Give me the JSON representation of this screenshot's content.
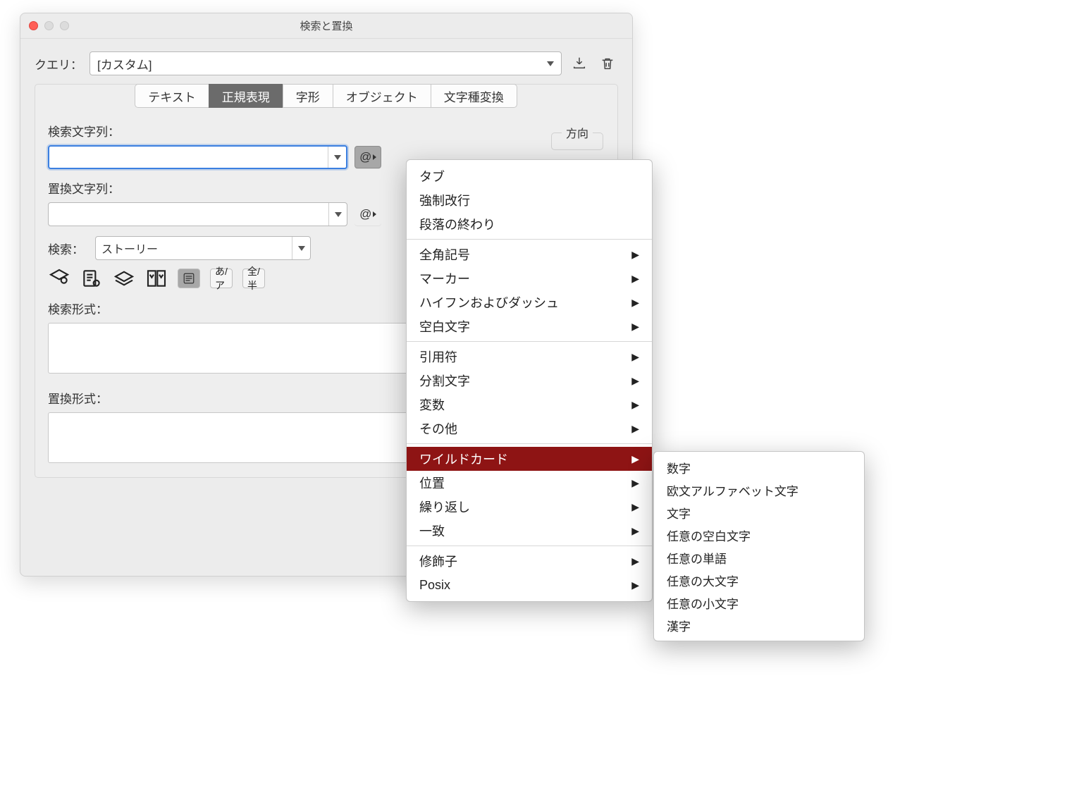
{
  "window": {
    "title": "検索と置換"
  },
  "query": {
    "label": "クエリ：",
    "value": "[カスタム]"
  },
  "tabs": {
    "text": "テキスト",
    "regex": "正規表現",
    "glyph": "字形",
    "object": "オブジェクト",
    "transliterate": "文字種変換"
  },
  "direction": {
    "legend": "方向"
  },
  "find": {
    "label": "検索文字列：",
    "at": "@"
  },
  "replace": {
    "label": "置換文字列：",
    "at": "@"
  },
  "search": {
    "label": "検索：",
    "value": "ストーリー"
  },
  "options": {
    "kana": "あ/ア",
    "width": "全/半"
  },
  "find_format": {
    "label": "検索形式："
  },
  "replace_format": {
    "label": "置換形式："
  },
  "menu": {
    "tab": "タブ",
    "forced_break": "強制改行",
    "end_para": "段落の終わり",
    "fullwidth_symbols": "全角記号",
    "markers": "マーカー",
    "hyphens_dashes": "ハイフンおよびダッシュ",
    "whitespace": "空白文字",
    "quotes": "引用符",
    "break_chars": "分割文字",
    "variables": "変数",
    "other": "その他",
    "wildcard": "ワイルドカード",
    "position": "位置",
    "repeat": "繰り返し",
    "match": "一致",
    "modifiers": "修飾子",
    "posix": "Posix"
  },
  "submenu": {
    "digit": "数字",
    "latin": "欧文アルファベット文字",
    "char": "文字",
    "any_space": "任意の空白文字",
    "any_word": "任意の単語",
    "any_upper": "任意の大文字",
    "any_lower": "任意の小文字",
    "kanji": "漢字"
  }
}
